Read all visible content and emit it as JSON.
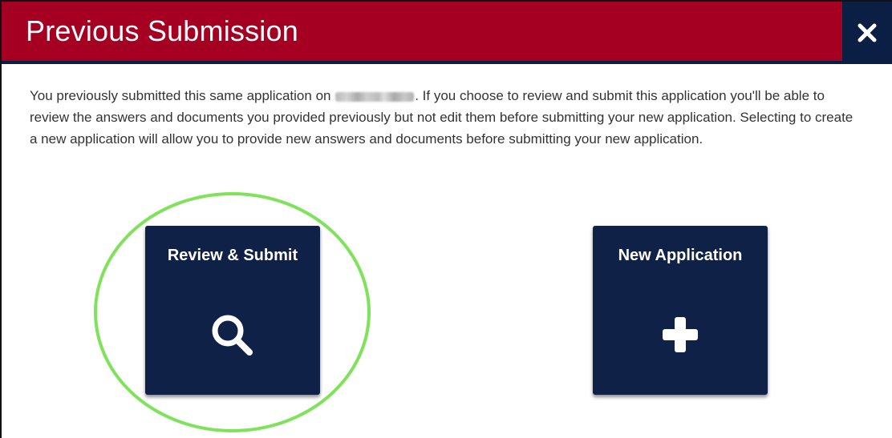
{
  "dialog": {
    "title": "Previous Submission",
    "close_label": "✕",
    "message_before": "You previously submitted this same application on",
    "message_after": ". If you choose to review and submit this application you'll be able to review the answers and documents you provided previously but not edit them before submitting your new application. Selecting to create a new application will allow you to provide new answers and documents before submitting your new application."
  },
  "options": {
    "review": {
      "label": "Review & Submit",
      "icon": "search-icon"
    },
    "new": {
      "label": "New Application",
      "icon": "plus-icon"
    }
  },
  "colors": {
    "header_red": "#a50021",
    "navy": "#0f2147",
    "highlight_green": "#7ee35a"
  }
}
